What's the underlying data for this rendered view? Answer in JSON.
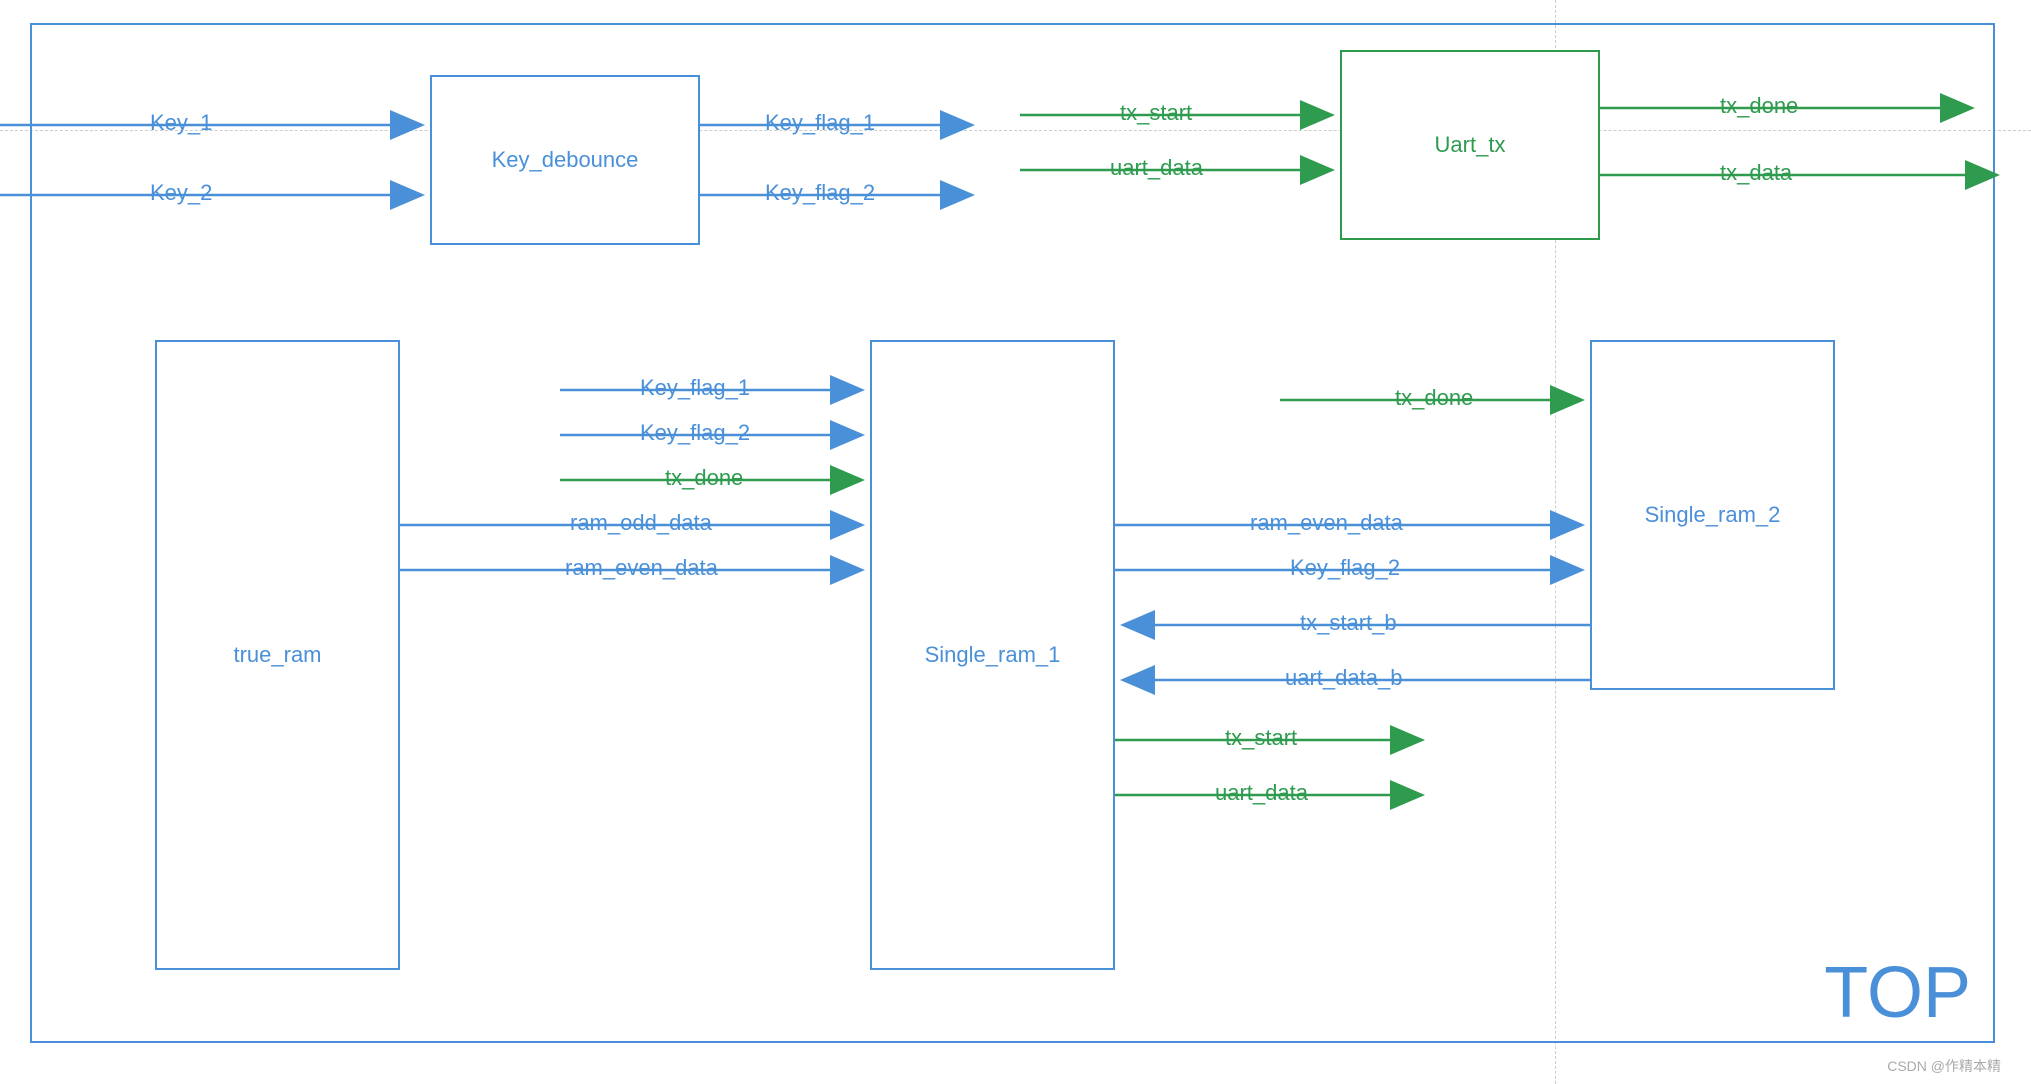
{
  "diagram": {
    "title": "TOP",
    "watermark": "CSDN @作精本精",
    "blocks": {
      "key_debounce": "Key_debounce",
      "uart_tx": "Uart_tx",
      "true_ram": "true_ram",
      "single_ram_1": "Single_ram_1",
      "single_ram_2": "Single_ram_2"
    },
    "signals": {
      "key_1": "Key_1",
      "key_2": "Key_2",
      "key_flag_1": "Key_flag_1",
      "key_flag_2": "Key_flag_2",
      "tx_start": "tx_start",
      "uart_data": "uart_data",
      "tx_done": "tx_done",
      "tx_data": "tx_data",
      "ram_odd_data": "ram_odd_data",
      "ram_even_data": "ram_even_data",
      "tx_start_b": "tx_start_b",
      "uart_data_b": "uart_data_b"
    }
  }
}
